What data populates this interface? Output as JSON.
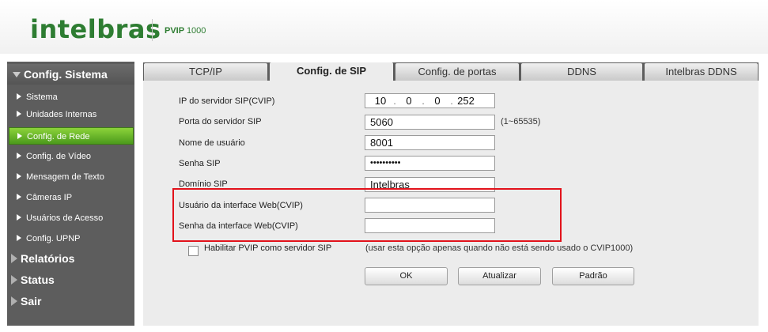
{
  "header": {
    "brand": "intelbras",
    "model_prefix": "PVIP",
    "model_number": "1000"
  },
  "sidebar": {
    "title": "Config. Sistema",
    "items": [
      {
        "label": "Sistema"
      },
      {
        "label": "Unidades Internas"
      },
      {
        "label": "Config. de Rede",
        "active": true
      },
      {
        "label": "Config. de Vídeo"
      },
      {
        "label": "Mensagem de Texto"
      },
      {
        "label": "Câmeras IP"
      },
      {
        "label": "Usuários de Acesso"
      },
      {
        "label": "Config. UPNP"
      }
    ],
    "categories": [
      {
        "label": "Relatórios"
      },
      {
        "label": "Status"
      },
      {
        "label": "Sair"
      }
    ]
  },
  "tabs": [
    {
      "label": "TCP/IP"
    },
    {
      "label": "Config. de SIP",
      "active": true
    },
    {
      "label": "Config. de portas"
    },
    {
      "label": "DDNS"
    },
    {
      "label": "Intelbras DDNS"
    }
  ],
  "form": {
    "sip_server_ip": {
      "label": "IP do servidor SIP(CVIP)",
      "octets": [
        "10",
        "0",
        "0",
        "252"
      ]
    },
    "sip_server_port": {
      "label": "Porta do servidor SIP",
      "value": "5060",
      "hint": "(1~65535)"
    },
    "username": {
      "label": "Nome de usuário",
      "value": "8001"
    },
    "sip_password": {
      "label": "Senha SIP",
      "value": "••••••••••"
    },
    "sip_domain": {
      "label": "Domínio SIP",
      "value": "Intelbras"
    },
    "web_user": {
      "label": "Usuário da interface Web(CVIP)",
      "value": ""
    },
    "web_password": {
      "label": "Senha da interface Web(CVIP)",
      "value": ""
    },
    "enable_pvip_sip": {
      "label": "Habilitar PVIP como servidor SIP",
      "note": "(usar esta opção apenas quando não está sendo usado o CVIP1000)",
      "checked": false
    }
  },
  "buttons": {
    "ok": "OK",
    "refresh": "Atualizar",
    "default": "Padrão"
  },
  "colors": {
    "brand_green": "#2e7d32",
    "active_menu_green": "#6cbf2a",
    "highlight_red": "#e2121b",
    "sidebar_gray": "#5d5d5d"
  }
}
